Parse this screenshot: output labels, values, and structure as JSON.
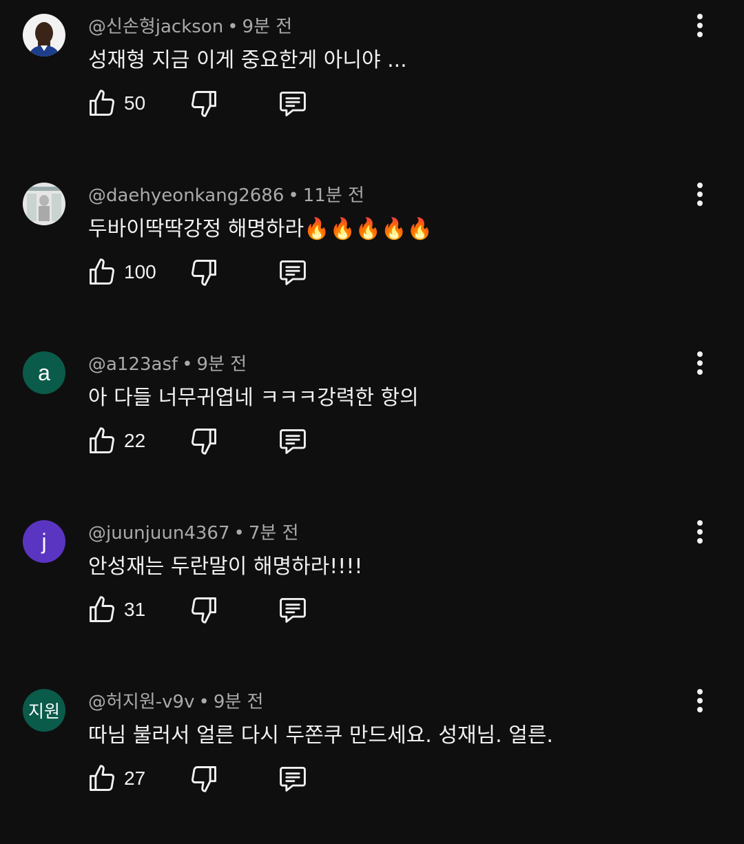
{
  "comments": [
    {
      "author": "@신손형jackson",
      "time": "9분 전",
      "text": "성재형 지금 이게 중요한게 아니야 ...",
      "likes": "50",
      "avatar": {
        "type": "photo",
        "letter": ""
      }
    },
    {
      "author": "@daehyeonkang2686",
      "time": "11분 전",
      "text": "두바이딱딱강정 해명하라🔥🔥🔥🔥🔥",
      "likes": "100",
      "avatar": {
        "type": "photo",
        "letter": ""
      }
    },
    {
      "author": "@a123asf",
      "time": "9분 전",
      "text": "아 다들 너무귀엽네 ㅋㅋㅋ강력한 항의",
      "likes": "22",
      "avatar": {
        "type": "letter",
        "letter": "a",
        "color": "#0b5b4a"
      }
    },
    {
      "author": "@juunjuun4367",
      "time": "7분 전",
      "text": "안성재는 두란말이 해명하라!!!!",
      "likes": "31",
      "avatar": {
        "type": "letter",
        "letter": "j",
        "color": "#5a35c2"
      }
    },
    {
      "author": "@허지원-v9v",
      "time": "9분 전",
      "text": "따님 불러서 얼른 다시 두쫀쿠 만드세요. 성재님. 얼른.",
      "likes": "27",
      "avatar": {
        "type": "letter",
        "letter": "지원",
        "color": "#0b5b4a"
      }
    }
  ],
  "separator": "•",
  "icons": {
    "like": "thumbs-up-icon",
    "dislike": "thumbs-down-icon",
    "reply": "reply-comment-icon",
    "more": "more-vert-icon"
  },
  "colors": {
    "background": "#0f0f0f",
    "text_primary": "#f1f1f1",
    "text_secondary": "#aaaaaa",
    "avatar_green": "#0b5b4a",
    "avatar_purple": "#5a35c2"
  }
}
